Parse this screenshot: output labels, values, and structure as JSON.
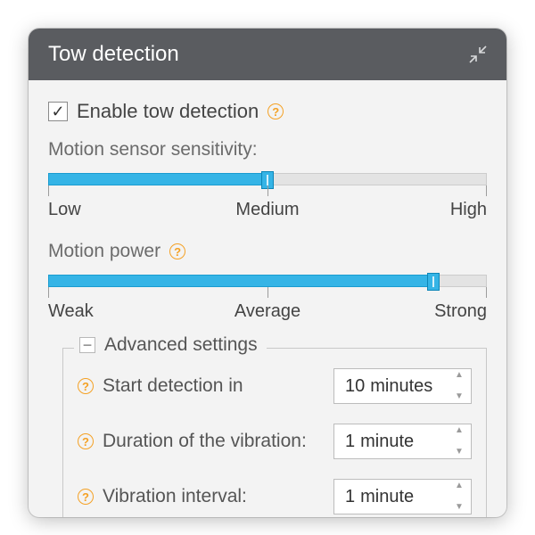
{
  "panel": {
    "title": "Tow detection"
  },
  "enable": {
    "label": "Enable tow detection",
    "checked": true
  },
  "slider_sensitivity": {
    "label": "Motion sensor sensitivity:",
    "percent": 50,
    "low": "Low",
    "mid": "Medium",
    "high": "High"
  },
  "slider_power": {
    "label": "Motion power",
    "percent": 88,
    "low": "Weak",
    "mid": "Average",
    "high": "Strong"
  },
  "advanced": {
    "legend": "Advanced settings",
    "rows": [
      {
        "label": "Start detection in",
        "value": "10",
        "unit": "minutes"
      },
      {
        "label": "Duration of the vibration:",
        "value": "1",
        "unit": "minute"
      },
      {
        "label": "Vibration interval:",
        "value": "1",
        "unit": "minute"
      }
    ]
  }
}
